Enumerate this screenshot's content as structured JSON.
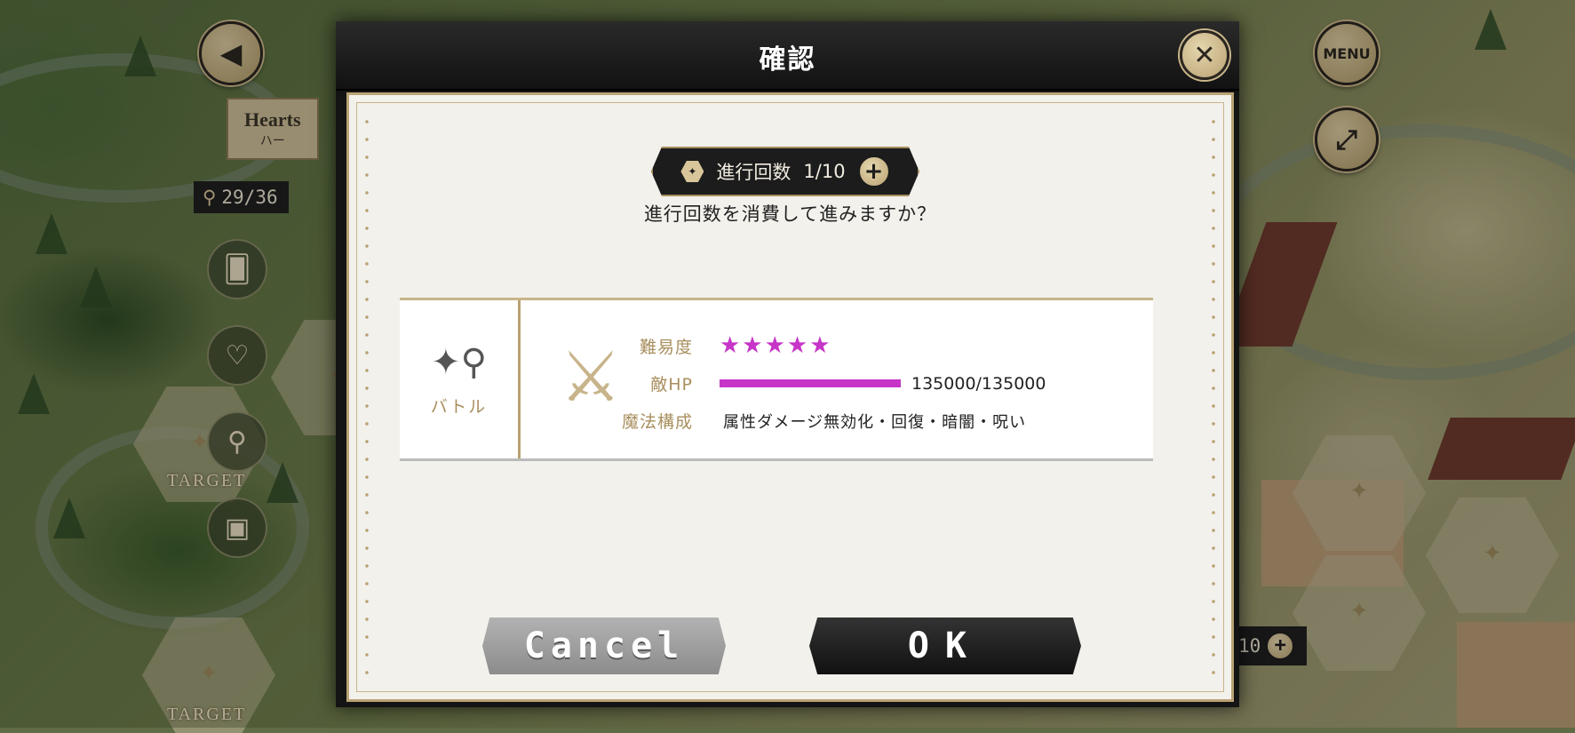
{
  "background": {
    "region_title": "Hearts",
    "region_subtitle": "ハー",
    "step_counter": "29/36",
    "target_label": "TARGET",
    "bottom_counter": "10",
    "menu_label": "MENU"
  },
  "dialog": {
    "title": "確認",
    "progress_label": "進行回数",
    "progress_value": "1/10",
    "question": "進行回数を消費して進みますか？",
    "info": {
      "type_label": "バトル",
      "difficulty_label": "難易度",
      "difficulty_stars": "★★★★★",
      "difficulty_value": 5,
      "hp_label": "敵HP",
      "hp_text": "135000/135000",
      "hp_fraction": 1.0,
      "magic_label": "魔法構成",
      "magic_value": "属性ダメージ無効化・回復・暗闇・呪い"
    },
    "cancel_label": "Cancel",
    "ok_label": "OK"
  },
  "colors": {
    "accent_gold": "#b9a273",
    "star_magenta": "#c635c8"
  },
  "icons": {
    "back": "chevron-left-icon",
    "close": "close-icon",
    "fullscreen": "expand-icon",
    "battle": "scepter-icon",
    "trident": "crossed-tridents-icon"
  }
}
